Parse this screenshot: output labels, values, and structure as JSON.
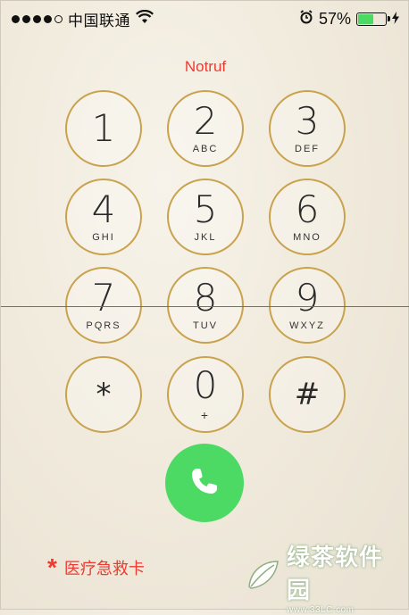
{
  "status_bar": {
    "signal_filled": 4,
    "signal_total": 5,
    "carrier": "中国联通",
    "battery_percent": "57%",
    "battery_level": 0.57,
    "battery_color": "#4cd964"
  },
  "emergency_title": "Notruf",
  "keys": [
    {
      "digit": "1",
      "letters": ""
    },
    {
      "digit": "2",
      "letters": "ABC"
    },
    {
      "digit": "3",
      "letters": "DEF"
    },
    {
      "digit": "4",
      "letters": "GHI"
    },
    {
      "digit": "5",
      "letters": "JKL"
    },
    {
      "digit": "6",
      "letters": "MNO"
    },
    {
      "digit": "7",
      "letters": "PQRS"
    },
    {
      "digit": "8",
      "letters": "TUV"
    },
    {
      "digit": "9",
      "letters": "WXYZ"
    },
    {
      "digit": "*",
      "letters": ""
    },
    {
      "digit": "0",
      "letters": "+"
    },
    {
      "digit": "#",
      "letters": ""
    }
  ],
  "medical_id": {
    "symbol": "*",
    "label": "医疗急救卡"
  },
  "watermark": {
    "name": "绿茶软件园",
    "url": "www.33LC.com"
  },
  "colors": {
    "accent_red": "#ee3a30",
    "key_ring": "#c9a24e",
    "call_green": "#4cd964"
  }
}
